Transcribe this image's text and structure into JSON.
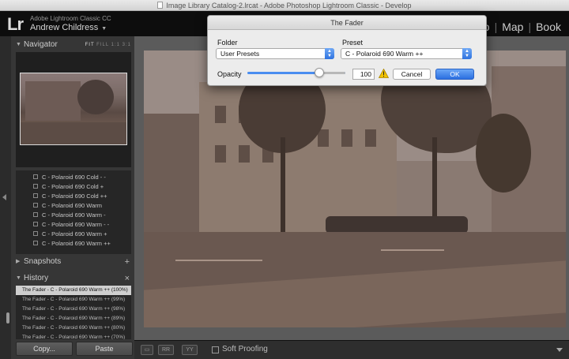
{
  "window": {
    "title": "Image Library Catalog-2.lrcat - Adobe Photoshop Lightroom Classic - Develop"
  },
  "identity": {
    "logo": "Lr",
    "app_name": "Adobe Lightroom Classic CC",
    "user_name": "Andrew Childress"
  },
  "modules": [
    "o",
    "Map",
    "Book"
  ],
  "navigator": {
    "title": "Navigator",
    "modes": [
      "FIT",
      "FILL",
      "1:1",
      "3:1"
    ]
  },
  "presets": [
    "C - Polaroid 690 Cold - -",
    "C - Polaroid 690 Cold +",
    "C - Polaroid 690 Cold ++",
    "C - Polaroid 690 Warm",
    "C - Polaroid 690 Warm -",
    "C - Polaroid 690 Warm - -",
    "C - Polaroid 690 Warm +",
    "C - Polaroid 690 Warm ++"
  ],
  "snapshots": {
    "title": "Snapshots",
    "action": "+"
  },
  "history": {
    "title": "History",
    "action": "×",
    "items": [
      "The Fader - C - Polaroid 690 Warm ++ (100%)",
      "The Fader - C - Polaroid 690 Warm ++ (99%)",
      "The Fader - C - Polaroid 690 Warm ++ (98%)",
      "The Fader - C - Polaroid 690 Warm ++ (89%)",
      "The Fader - C - Polaroid 690 Warm ++ (80%)",
      "The Fader - C - Polaroid 690 Warm ++ (70%)"
    ]
  },
  "buttons": {
    "copy": "Copy...",
    "paste": "Paste"
  },
  "toolbar": {
    "view_btn": "▭",
    "ry_btn": "RR",
    "yy_btn": "YY",
    "soft_proofing": "Soft Proofing"
  },
  "dialog": {
    "title": "The Fader",
    "folder_label": "Folder",
    "folder_value": "User Presets",
    "preset_label": "Preset",
    "preset_value": "C - Polaroid 690 Warm ++",
    "opacity_label": "Opacity",
    "opacity_value": "100",
    "opacity_fraction": 0.73,
    "cancel_label": "Cancel",
    "ok_label": "OK"
  },
  "colors": {
    "accent": "#2f73e0",
    "warning": "#f2c300"
  }
}
